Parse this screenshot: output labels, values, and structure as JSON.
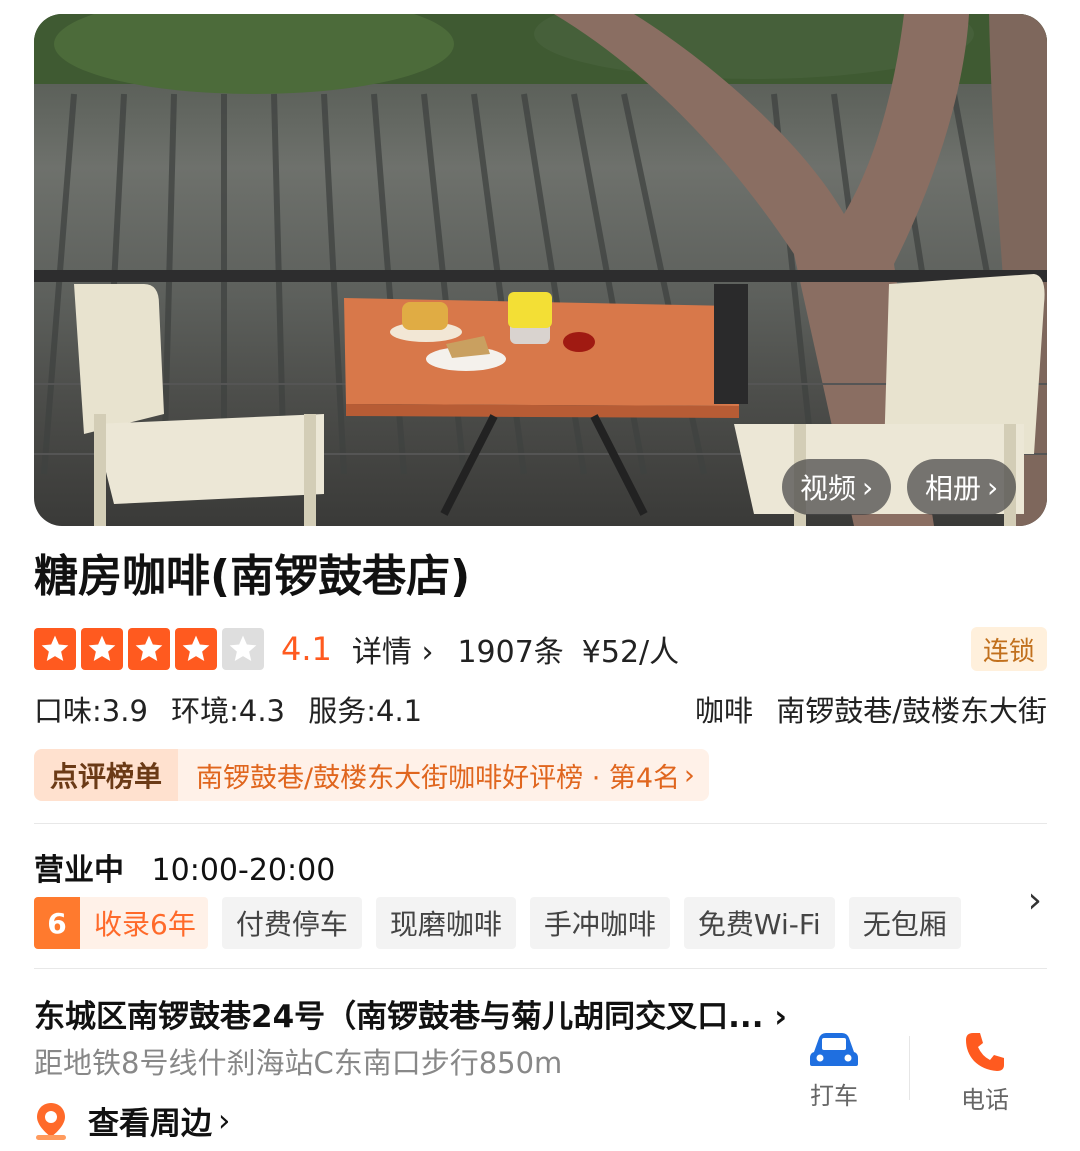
{
  "hero": {
    "video_label": "视频",
    "album_label": "相册",
    "chevron": "›"
  },
  "shop": {
    "name": "糖房咖啡(南锣鼓巷店)",
    "rating": {
      "stars_filled": 4,
      "stars_total": 5,
      "score": "4.1",
      "detail_label": "详情",
      "review_count": "1907条",
      "price": "¥52/人"
    },
    "chain_badge": "连锁",
    "sub_scores": {
      "taste": "口味:3.9",
      "env": "环境:4.3",
      "service": "服务:4.1"
    },
    "category": "咖啡",
    "area": "南锣鼓巷/鼓楼东大街"
  },
  "ranking": {
    "title": "点评榜单",
    "text": "南锣鼓巷/鼓楼东大街咖啡好评榜 · 第4名"
  },
  "hours": {
    "status": "营业中",
    "time": "10:00-20:00"
  },
  "tags": {
    "years_num": "6",
    "years_label": "收录6年",
    "items": [
      "付费停车",
      "现磨咖啡",
      "手冲咖啡",
      "免费Wi-Fi",
      "无包厢"
    ]
  },
  "address": {
    "text": "东城区南锣鼓巷24号（南锣鼓巷与菊儿胡同交叉口...",
    "metro": "距地铁8号线什刹海站C东南口步行850m",
    "nearby_label": "查看周边"
  },
  "actions": {
    "taxi_label": "打车",
    "phone_label": "电话"
  },
  "colors": {
    "accent": "#ff5a1f",
    "badge_bg": "#fff0dc",
    "badge_fg": "#c1701d",
    "rank_fg": "#e0661e",
    "taxi_icon": "#1f6fe0",
    "phone_icon": "#ff5a1f"
  },
  "icons": [
    "star-icon",
    "chevron-right-icon",
    "location-pin-icon",
    "car-icon",
    "phone-icon"
  ]
}
